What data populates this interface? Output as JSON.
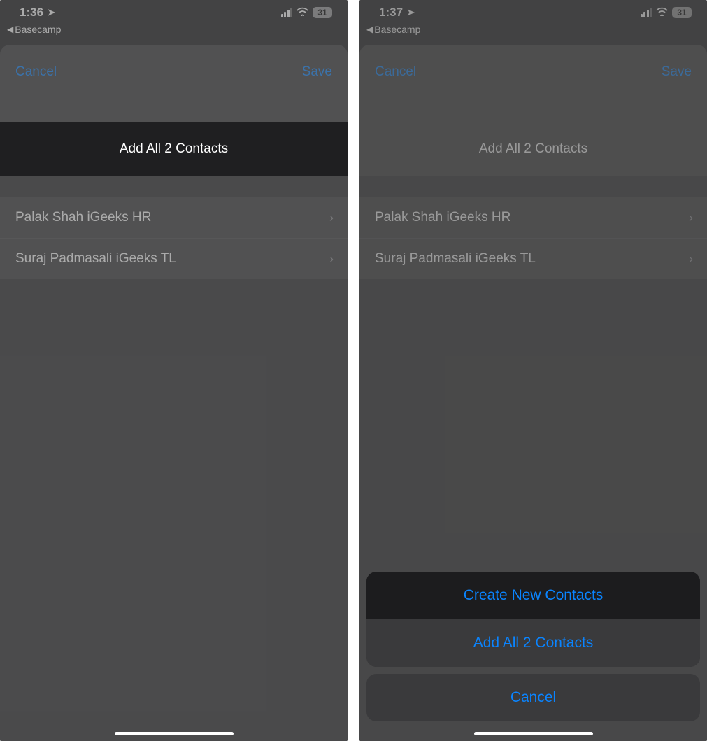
{
  "left": {
    "status": {
      "time": "1:36",
      "battery": "31"
    },
    "back_app": "Basecamp",
    "sheet": {
      "cancel": "Cancel",
      "save": "Save"
    },
    "add_all_label": "Add All 2 Contacts",
    "contacts": [
      {
        "name": "Palak Shah iGeeks HR"
      },
      {
        "name": "Suraj Padmasali iGeeks TL"
      }
    ]
  },
  "right": {
    "status": {
      "time": "1:37",
      "battery": "31"
    },
    "back_app": "Basecamp",
    "sheet": {
      "cancel": "Cancel",
      "save": "Save"
    },
    "add_all_label": "Add All 2 Contacts",
    "contacts": [
      {
        "name": "Palak Shah iGeeks HR"
      },
      {
        "name": "Suraj Padmasali iGeeks TL"
      }
    ],
    "action_sheet": {
      "create_new": "Create New Contacts",
      "add_all": "Add All 2 Contacts",
      "cancel": "Cancel"
    }
  }
}
